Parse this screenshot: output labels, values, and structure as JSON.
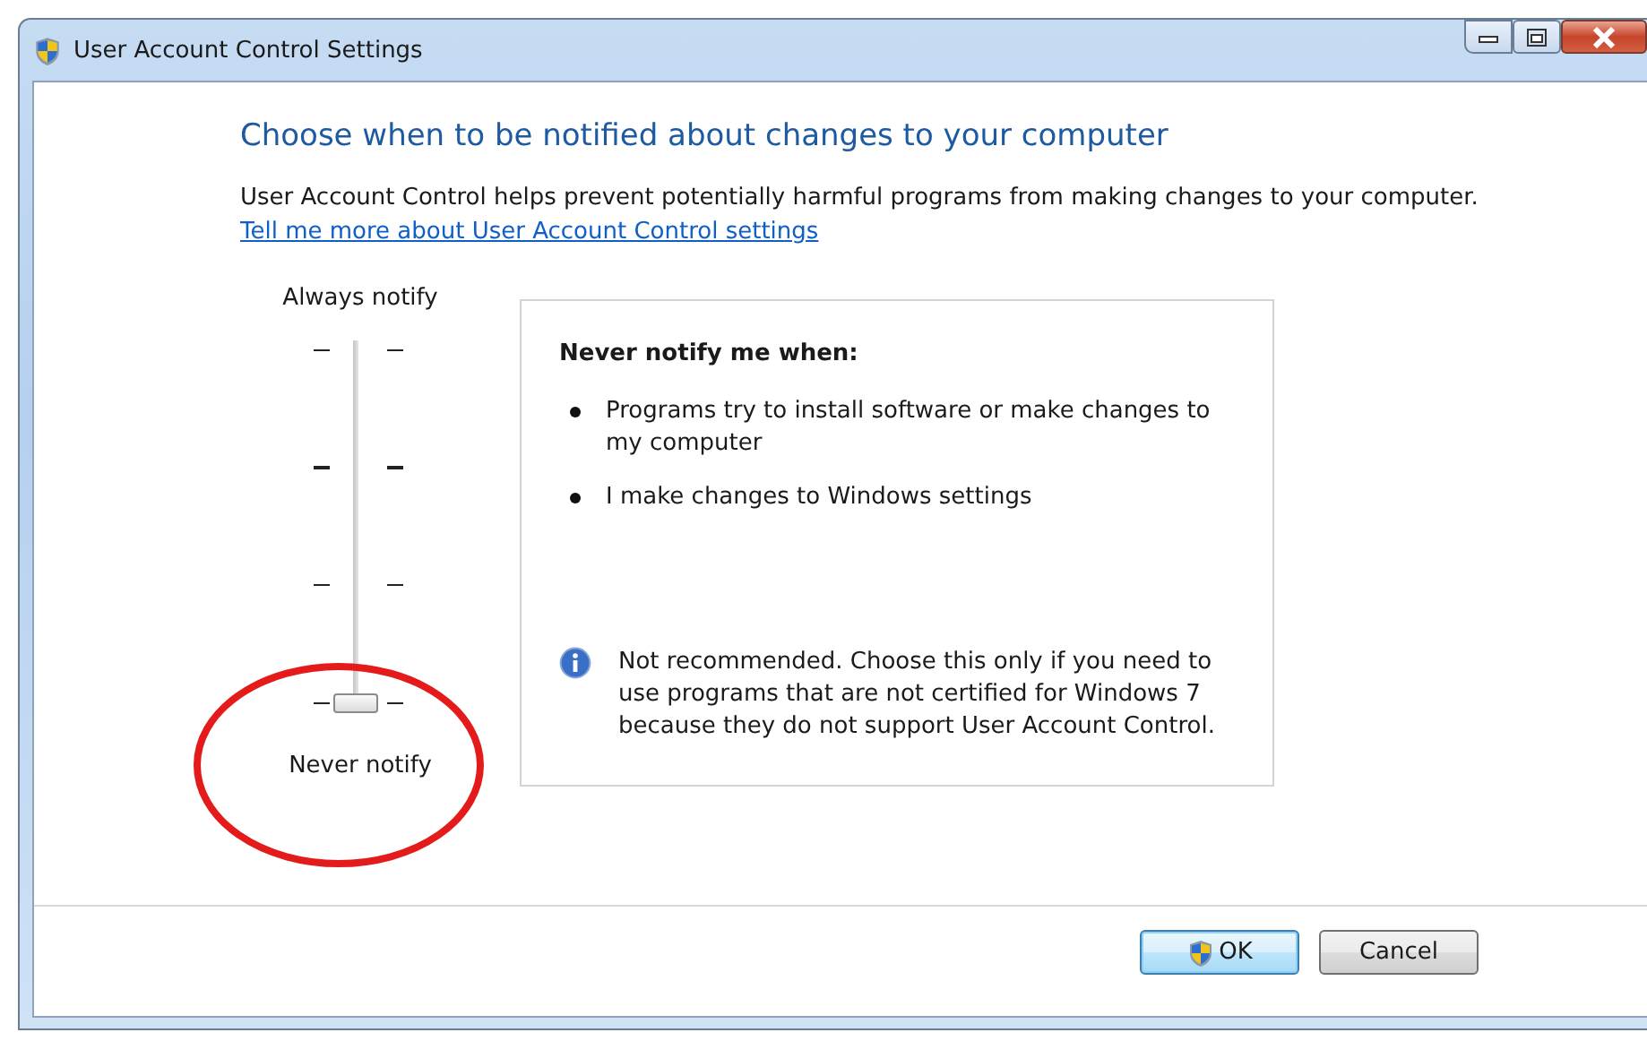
{
  "window": {
    "title": "User Account Control Settings"
  },
  "heading": "Choose when to be notified about changes to your computer",
  "description": "User Account Control helps prevent potentially harmful programs from making changes to your computer.",
  "link": "Tell me more about User Account Control settings",
  "slider": {
    "top_label": "Always notify",
    "bottom_label": "Never notify",
    "level": 0
  },
  "info_panel": {
    "title": "Never notify me when:",
    "bullets": [
      "Programs try to install software or make changes to my computer",
      "I make changes to Windows settings"
    ],
    "note": "Not recommended. Choose this only if you need to use programs that are not certified for Windows 7 because they do not support User Account Control."
  },
  "buttons": [
    {
      "label": "OK",
      "kind": "shield",
      "default": true
    },
    {
      "label": "Cancel",
      "kind": "plain",
      "default": false
    }
  ]
}
